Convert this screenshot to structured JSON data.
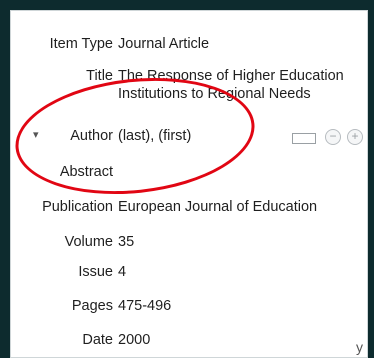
{
  "fields": [
    {
      "label": "Item Type",
      "value": "Journal Article"
    },
    {
      "label": "Title",
      "value": "The Response of Higher Education Institutions to Regional Needs"
    },
    {
      "label": "Author",
      "value": "(last), (first)"
    },
    {
      "label": "Abstract",
      "value": ""
    },
    {
      "label": "Publication",
      "value": "European Journal of Education"
    },
    {
      "label": "Volume",
      "value": "35"
    },
    {
      "label": "Issue",
      "value": "4"
    },
    {
      "label": "Pages",
      "value": "475-496"
    },
    {
      "label": "Date",
      "value": "2000"
    }
  ],
  "author_twisty": "▾",
  "author_buttons": {
    "minus": "−",
    "plus": "+"
  },
  "corner_text": "y",
  "colors": {
    "annotation": "#e10613",
    "background": "#0d2b2e"
  }
}
